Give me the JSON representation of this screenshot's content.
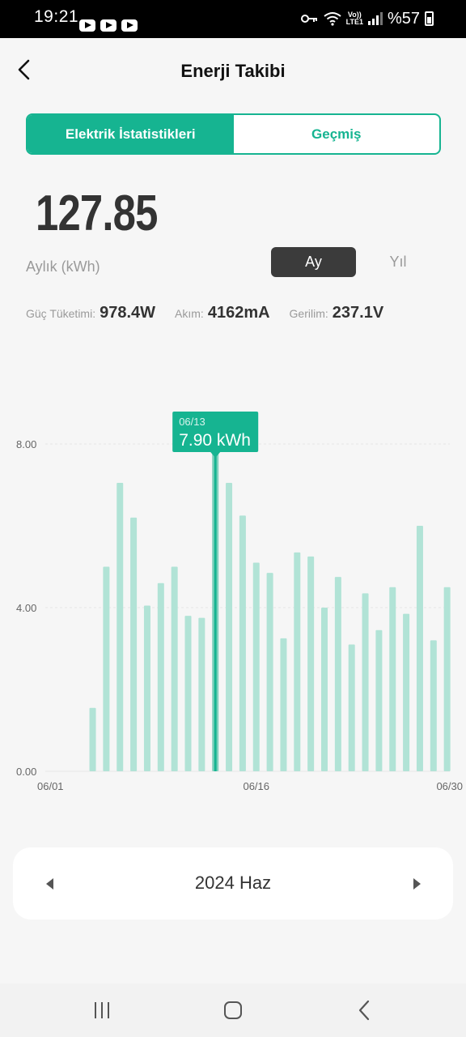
{
  "status_bar": {
    "time": "19:21",
    "battery": "%57",
    "network": "LTE1",
    "volte": "Vo))",
    "icons": [
      "youtube-icon",
      "youtube-icon",
      "youtube-icon",
      "vpn-key-icon",
      "wifi-icon",
      "signal-icon",
      "battery-icon"
    ]
  },
  "header": {
    "title": "Enerji Takibi",
    "back_icon": "chevron-left-icon"
  },
  "tabs": [
    {
      "label": "Elektrik İstatistikleri",
      "active": true
    },
    {
      "label": "Geçmiş",
      "active": false
    }
  ],
  "summary": {
    "value_int": "127",
    "value_dec": ".85",
    "unit_label": "Aylık (kWh)",
    "period_options": [
      {
        "label": "Ay",
        "selected": true
      },
      {
        "label": "Yıl",
        "selected": false
      }
    ]
  },
  "stats": [
    {
      "label": "Güç Tüketimi:",
      "value": "978.4W"
    },
    {
      "label": "Akım:",
      "value": "4162mA"
    },
    {
      "label": "Gerilim:",
      "value": "237.1V"
    }
  ],
  "chart_data": {
    "type": "bar",
    "x_tick_labels": [
      "06/01",
      "06/16",
      "06/30"
    ],
    "y_tick_labels": [
      "0.00",
      "4.00",
      "8.00"
    ],
    "ylim": [
      0,
      8
    ],
    "grid": true,
    "days": [
      "06/01",
      "06/02",
      "06/03",
      "06/04",
      "06/05",
      "06/06",
      "06/07",
      "06/08",
      "06/09",
      "06/10",
      "06/11",
      "06/12",
      "06/13",
      "06/14",
      "06/15",
      "06/16",
      "06/17",
      "06/18",
      "06/19",
      "06/20",
      "06/21",
      "06/22",
      "06/23",
      "06/24",
      "06/25",
      "06/26",
      "06/27",
      "06/28",
      "06/29",
      "06/30"
    ],
    "values": [
      0,
      0,
      0,
      1.55,
      5.0,
      7.05,
      6.2,
      4.05,
      4.6,
      5.0,
      3.8,
      3.75,
      7.9,
      7.05,
      6.25,
      5.1,
      4.85,
      3.25,
      5.35,
      5.25,
      4.0,
      4.75,
      3.1,
      4.35,
      3.45,
      4.5,
      3.85,
      6.0,
      3.2,
      4.5
    ],
    "selected_index": 12,
    "tooltip": {
      "date": "06/13",
      "value": "7.90 kWh"
    },
    "bar_color": "#b1e3d6",
    "selected_color": "#16b491"
  },
  "month_selector": {
    "label": "2024 Haz",
    "prev_icon": "caret-left-icon",
    "next_icon": "caret-right-icon"
  },
  "nav_bar": {
    "icons": [
      "recent-apps-icon",
      "home-icon",
      "back-icon"
    ]
  },
  "colors": {
    "accent": "#16b491",
    "dark": "#3b3b3b"
  }
}
